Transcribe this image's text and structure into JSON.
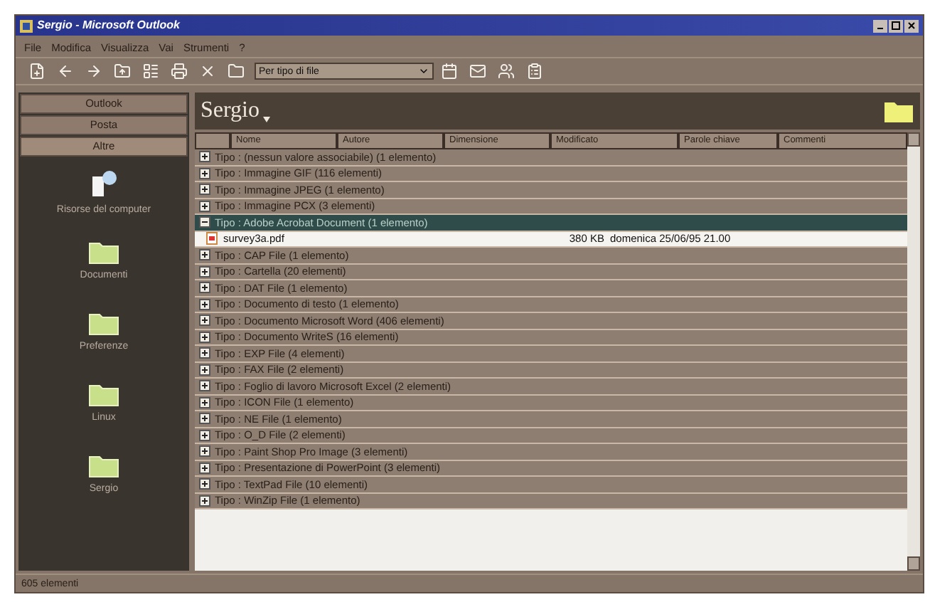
{
  "window": {
    "title": "Sergio - Microsoft Outlook"
  },
  "menu": [
    "File",
    "Modifica",
    "Visualizza",
    "Vai",
    "Strumenti",
    "?"
  ],
  "toolbar": {
    "view_combo": "Per tipo di file"
  },
  "outlook_bar": {
    "groups": [
      {
        "label": "Outlook",
        "selected": false
      },
      {
        "label": "Posta",
        "selected": false
      },
      {
        "label": "Altre",
        "selected": true
      }
    ],
    "items": [
      {
        "kind": "computer",
        "label": "Risorse del computer"
      },
      {
        "kind": "folder",
        "label": "Documenti"
      },
      {
        "kind": "folder",
        "label": "Preferenze"
      },
      {
        "kind": "folder",
        "label": "Linux"
      },
      {
        "kind": "folder",
        "label": "Sergio"
      }
    ]
  },
  "folder_header": {
    "title": "Sergio"
  },
  "table": {
    "columns": [
      "Nome",
      "Autore",
      "Dimensione",
      "Modificato",
      "Parole chiave",
      "Commenti"
    ],
    "groups": [
      {
        "label": "Tipo : (nessun valore associabile) (1 elemento)",
        "expanded": false,
        "selected": false
      },
      {
        "label": "Tipo : Immagine GIF (116 elementi)",
        "expanded": false,
        "selected": false
      },
      {
        "label": "Tipo : Immagine JPEG (1 elemento)",
        "expanded": false,
        "selected": false
      },
      {
        "label": "Tipo : Immagine PCX (3 elementi)",
        "expanded": false,
        "selected": false
      },
      {
        "label": "Tipo : Adobe Acrobat Document (1 elemento)",
        "expanded": true,
        "selected": true,
        "files": [
          {
            "name": "survey3a.pdf",
            "size": "380 KB",
            "modified": "domenica 25/06/95 21.00"
          }
        ]
      },
      {
        "label": "Tipo : CAP File (1 elemento)",
        "expanded": false,
        "selected": false
      },
      {
        "label": "Tipo : Cartella (20 elementi)",
        "expanded": false,
        "selected": false
      },
      {
        "label": "Tipo : DAT File (1 elemento)",
        "expanded": false,
        "selected": false
      },
      {
        "label": "Tipo : Documento di testo (1 elemento)",
        "expanded": false,
        "selected": false
      },
      {
        "label": "Tipo : Documento Microsoft Word (406 elementi)",
        "expanded": false,
        "selected": false
      },
      {
        "label": "Tipo : Documento WriteS (16 elementi)",
        "expanded": false,
        "selected": false
      },
      {
        "label": "Tipo : EXP File (4 elementi)",
        "expanded": false,
        "selected": false
      },
      {
        "label": "Tipo : FAX File (2 elementi)",
        "expanded": false,
        "selected": false
      },
      {
        "label": "Tipo : Foglio di lavoro Microsoft Excel (2 elementi)",
        "expanded": false,
        "selected": false
      },
      {
        "label": "Tipo : ICON File (1 elemento)",
        "expanded": false,
        "selected": false
      },
      {
        "label": "Tipo : NE File (1 elemento)",
        "expanded": false,
        "selected": false
      },
      {
        "label": "Tipo : O_D File (2 elementi)",
        "expanded": false,
        "selected": false
      },
      {
        "label": "Tipo : Paint Shop Pro Image (3 elementi)",
        "expanded": false,
        "selected": false
      },
      {
        "label": "Tipo : Presentazione di PowerPoint (3 elementi)",
        "expanded": false,
        "selected": false
      },
      {
        "label": "Tipo : TextPad File (10 elementi)",
        "expanded": false,
        "selected": false
      },
      {
        "label": "Tipo : WinZip File (1 elemento)",
        "expanded": false,
        "selected": false
      }
    ]
  },
  "status_bar": "605 elementi"
}
